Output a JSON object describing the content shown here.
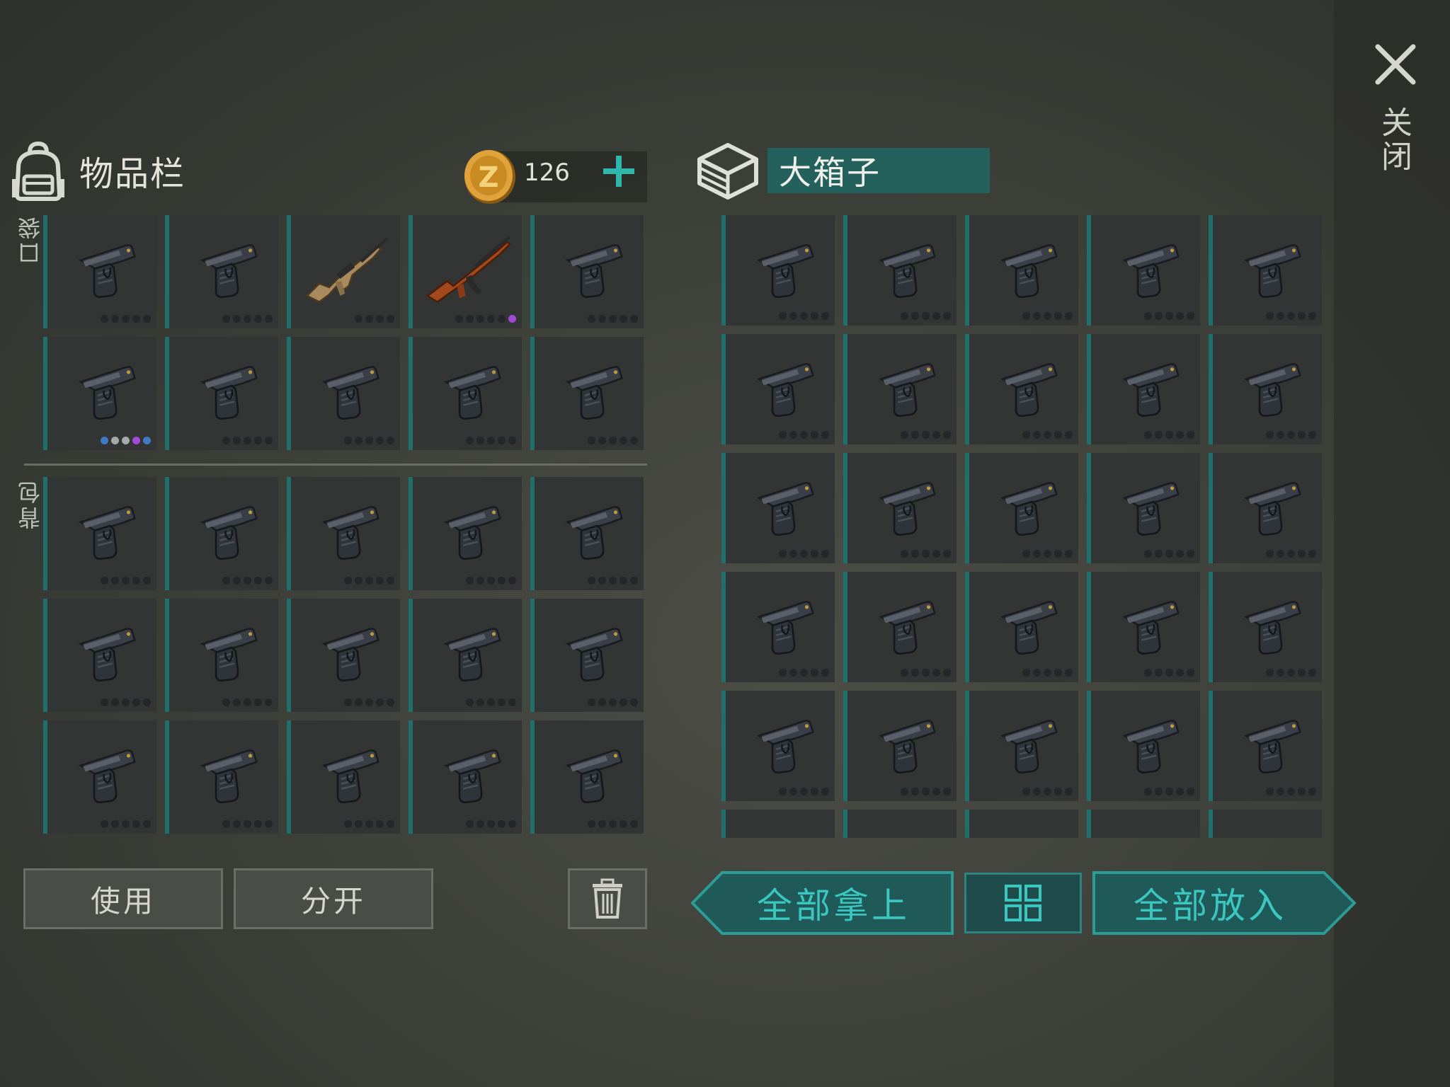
{
  "close": {
    "label": "关闭",
    "icon": "close-icon"
  },
  "inventory": {
    "title": "物品栏",
    "icon": "backpack-icon",
    "coins": {
      "value": "126",
      "icon": "coin-icon",
      "plus_icon": "plus-icon"
    },
    "pocket_label": "口袋",
    "backpack_label": "背包",
    "pocket_slots": [
      {
        "item": "pistol",
        "dots": [
          "#24262a",
          "#24262a",
          "#24262a",
          "#24262a",
          "#24262a"
        ]
      },
      {
        "item": "pistol",
        "dots": [
          "#24262a",
          "#24262a",
          "#24262a",
          "#24262a",
          "#24262a"
        ]
      },
      {
        "item": "assault-rifle-scar",
        "dots": [
          "#24262a",
          "#24262a",
          "#24262a",
          "#24262a"
        ]
      },
      {
        "item": "assault-rifle-ak",
        "dots": [
          "#24262a",
          "#24262a",
          "#24262a",
          "#24262a",
          "#24262a",
          "#a24ad8"
        ]
      },
      {
        "item": "pistol",
        "dots": [
          "#24262a",
          "#24262a",
          "#24262a",
          "#24262a",
          "#24262a"
        ]
      },
      {
        "item": "pistol",
        "dots": [
          "#3f7bc4",
          "#a8a8a8",
          "#a8a8a8",
          "#a24ad8",
          "#3f7bc4"
        ]
      },
      {
        "item": "pistol",
        "dots": [
          "#24262a",
          "#24262a",
          "#24262a",
          "#24262a",
          "#24262a"
        ]
      },
      {
        "item": "pistol",
        "dots": [
          "#24262a",
          "#24262a",
          "#24262a",
          "#24262a",
          "#24262a"
        ]
      },
      {
        "item": "pistol",
        "dots": [
          "#24262a",
          "#24262a",
          "#24262a",
          "#24262a",
          "#24262a"
        ]
      },
      {
        "item": "pistol",
        "dots": [
          "#24262a",
          "#24262a",
          "#24262a",
          "#24262a",
          "#24262a"
        ]
      }
    ],
    "backpack_slot_count": 15,
    "use_label": "使用",
    "split_label": "分开",
    "trash_icon": "trash-icon"
  },
  "box": {
    "title": "大箱子",
    "icon": "crate-icon",
    "slot_count": 30,
    "take_all_label": "全部拿上",
    "sort_icon": "sort-grid-icon",
    "put_all_label": "全部放入"
  },
  "colors": {
    "teal": "#1f6f6c",
    "teal_text": "#3cc6c0",
    "slot_bg": "#323533"
  }
}
